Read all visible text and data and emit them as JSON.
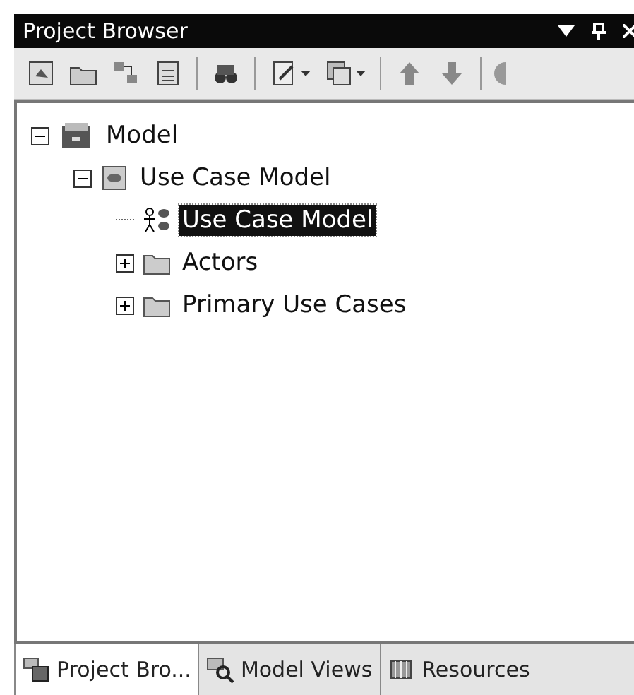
{
  "window": {
    "title": "Project Browser"
  },
  "tree": [
    {
      "label": "Model",
      "kind": "model",
      "expanded": true,
      "selected": false,
      "children": [
        {
          "label": "Use Case Model",
          "kind": "package",
          "expanded": true,
          "selected": false,
          "children": [
            {
              "label": "Use Case Model",
              "kind": "diagram",
              "selected": true
            },
            {
              "label": "Actors",
              "kind": "folder",
              "expanded": false,
              "selected": false
            },
            {
              "label": "Primary Use Cases",
              "kind": "folder",
              "expanded": false,
              "selected": false
            }
          ]
        }
      ]
    }
  ],
  "tabs": [
    {
      "label": "Project Bro...",
      "selected": true
    },
    {
      "label": "Model Views",
      "selected": false
    },
    {
      "label": "Resources",
      "selected": false
    }
  ]
}
